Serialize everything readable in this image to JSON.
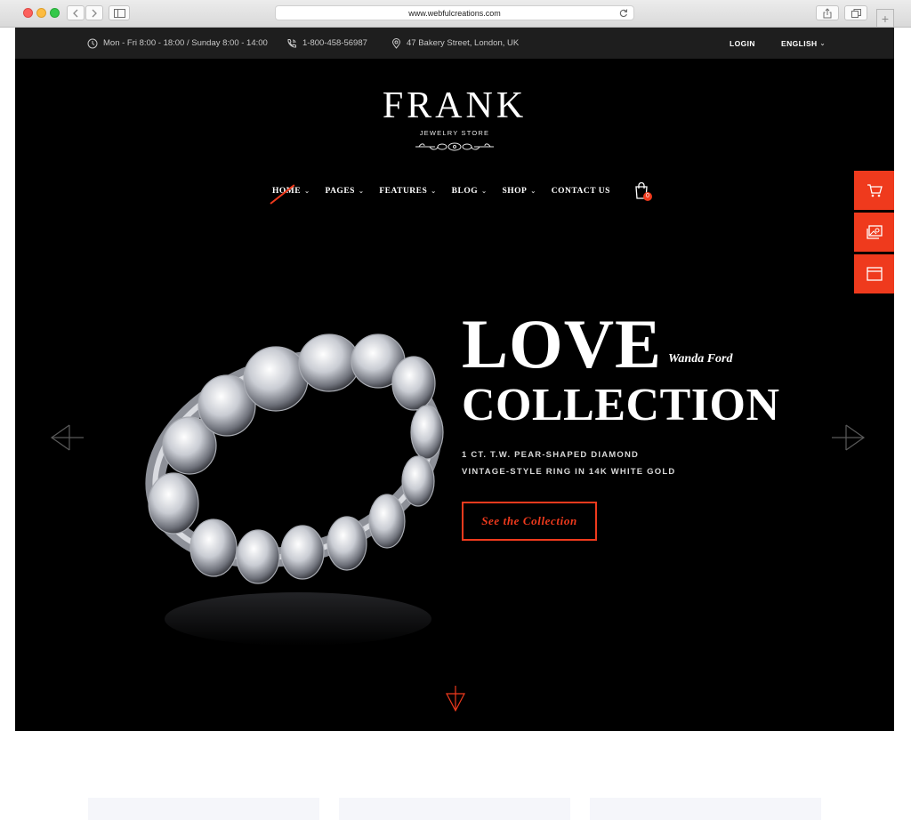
{
  "browser": {
    "url": "www.webfulcreations.com",
    "new_tab_symbol": "+"
  },
  "topbar": {
    "hours": "Mon - Fri 8:00 - 18:00 / Sunday 8:00 - 14:00",
    "phone": "1-800-458-56987",
    "address": "47 Bakery Street, London, UK",
    "login": "LOGIN",
    "language": "ENGLISH"
  },
  "logo": {
    "name": "FRANK",
    "tagline": "JEWELRY STORE"
  },
  "nav": {
    "items": [
      {
        "label": "HOME",
        "has_menu": true
      },
      {
        "label": "PAGES",
        "has_menu": true
      },
      {
        "label": "FEATURES",
        "has_menu": true
      },
      {
        "label": "BLOG",
        "has_menu": true
      },
      {
        "label": "SHOP",
        "has_menu": true
      },
      {
        "label": "CONTACT US",
        "has_menu": false
      }
    ],
    "chevron": "⌄",
    "cart_count": "0"
  },
  "hero": {
    "title_line1": "LOVE",
    "author": "Wanda Ford",
    "title_line2": "COLLECTION",
    "sub_line1": "1 CT. T.W. PEAR-SHAPED DIAMOND",
    "sub_line2": "VINTAGE-STYLE RING IN 14K WHITE GOLD",
    "cta": "See the Collection"
  },
  "colors": {
    "accent": "#ef3a1d",
    "topbar": "#1e1e1e",
    "hero_bg": "#000000"
  },
  "icons": {
    "topbar": [
      "clock-icon",
      "phone-icon",
      "location-pin-icon"
    ],
    "side_tools": [
      "cart-icon",
      "image-gallery-icon",
      "browser-window-icon"
    ]
  }
}
